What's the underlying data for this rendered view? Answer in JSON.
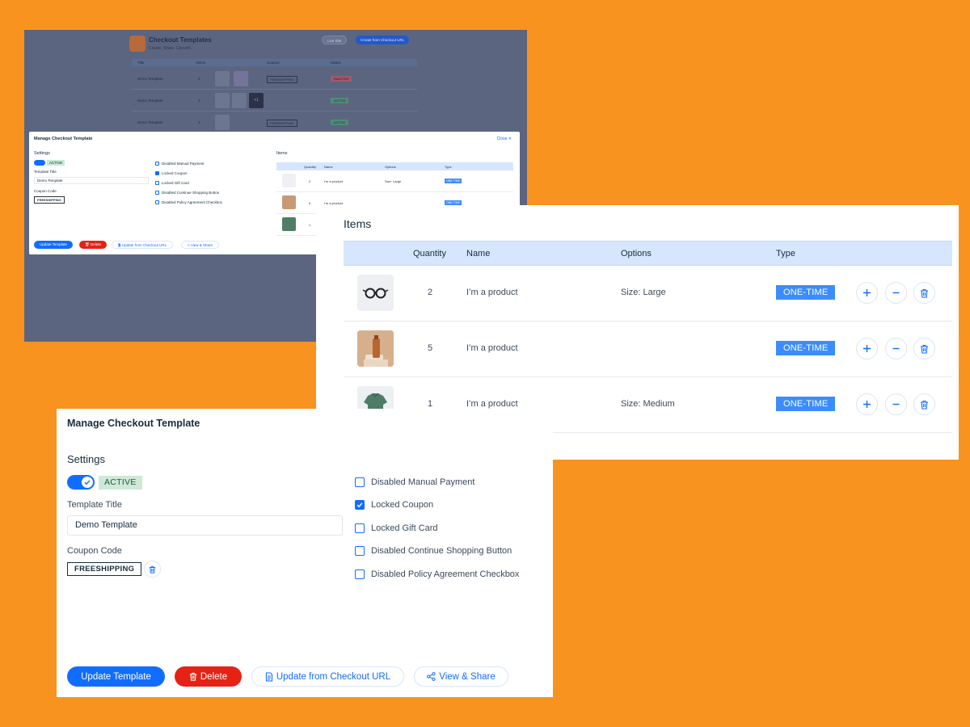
{
  "colors": {
    "backdrop": "#F7931E",
    "primary": "#116DFF",
    "danger": "#E62214",
    "badge_bg": "#CFE8D8",
    "type_badge": "#3B8CFF",
    "table_header": "#D6E6FE"
  },
  "background_dashboard": {
    "title": "Checkout Templates",
    "subtitle": "Create. Share. Convert.",
    "live_site": "Live Site",
    "create_button": "Create from Checkout URL",
    "columns": [
      "Title",
      "Items",
      "Coupon",
      "Status"
    ],
    "rows": [
      {
        "title": "Demo Template",
        "items": "2",
        "coupon": "FREESHIPPING",
        "status": "INACTIVE"
      },
      {
        "title": "Demo Template",
        "items": "4",
        "coupon": "",
        "status": "ACTIVE",
        "more": "+1"
      },
      {
        "title": "Demo Template",
        "items": "1",
        "coupon": "FREESHIPPING",
        "status": "ACTIVE"
      }
    ]
  },
  "background_modal": {
    "title": "Manage Checkout Template",
    "close": "Close ✕",
    "settings": "Settings",
    "active": "ACTIVE",
    "template_title_label": "Template Title",
    "template_title_value": "Demo Template",
    "coupon_label": "Coupon Code",
    "coupon_value": "FREESHIPPING",
    "checks": [
      "Disabled Manual Payment",
      "Locked Coupon",
      "Locked Gift Card",
      "Disabled Continue Shopping Button",
      "Disabled Policy Agreement Checkbox"
    ],
    "items_title": "Items",
    "columns": [
      "Quantity",
      "Name",
      "Options",
      "Type"
    ],
    "rows": [
      {
        "qty": "2",
        "name": "I'm a product",
        "options": "Size: Large",
        "type": "ONE-TIME"
      },
      {
        "qty": "5",
        "name": "I'm a product",
        "options": "",
        "type": "ONE-TIME"
      },
      {
        "qty": "1",
        "name": "I'm a product",
        "options": "",
        "type": ""
      }
    ],
    "buttons": {
      "update": "Update Template",
      "delete": "🗑 Delete",
      "checkout": "🗎 Update from Checkout URL",
      "share": "< View & Share"
    }
  },
  "items": {
    "title": "Items",
    "columns": {
      "quantity": "Quantity",
      "name": "Name",
      "options": "Options",
      "type": "Type"
    },
    "rows": [
      {
        "thumb_icon": "glasses-icon",
        "quantity": "2",
        "name": "I’m a product",
        "options": "Size: Large",
        "type": "ONE-TIME"
      },
      {
        "thumb_icon": "bottle-icon",
        "quantity": "5",
        "name": "I’m a product",
        "options": "",
        "type": "ONE-TIME"
      },
      {
        "thumb_icon": "shirt-icon",
        "quantity": "1",
        "name": "I’m a product",
        "options": "Size: Medium",
        "type": "ONE-TIME"
      }
    ]
  },
  "manage": {
    "title": "Manage Checkout Template",
    "settings_heading": "Settings",
    "status_toggle_on": true,
    "status_badge": "ACTIVE",
    "template_title_label": "Template Title",
    "template_title_value": "Demo Template",
    "coupon_label": "Coupon Code",
    "coupon_value": "FREESHIPPING",
    "options": [
      {
        "label": "Disabled Manual Payment",
        "checked": false
      },
      {
        "label": "Locked Coupon",
        "checked": true
      },
      {
        "label": "Locked Gift Card",
        "checked": false
      },
      {
        "label": "Disabled Continue Shopping Button",
        "checked": false
      },
      {
        "label": "Disabled Policy Agreement Checkbox",
        "checked": false
      }
    ],
    "buttons": {
      "update": "Update Template",
      "delete": "Delete",
      "checkout": "Update from Checkout URL",
      "share": "View & Share"
    }
  }
}
